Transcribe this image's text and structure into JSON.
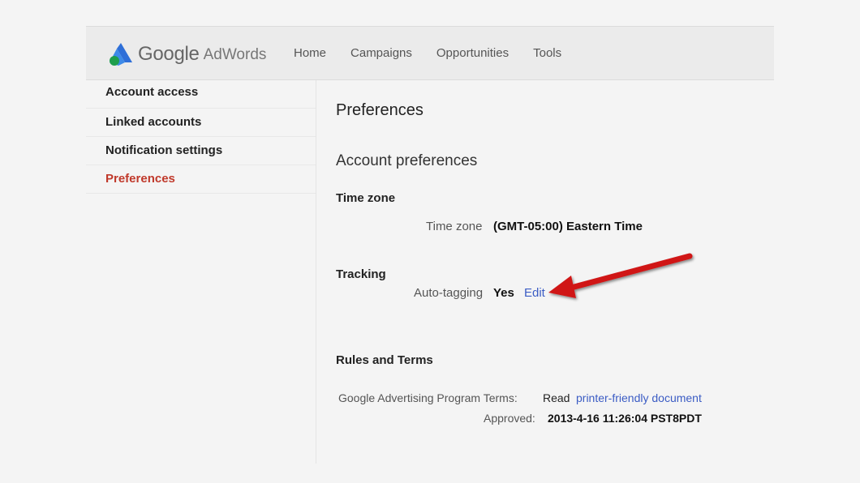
{
  "brand": {
    "google": "Google",
    "product": "AdWords"
  },
  "nav": {
    "items": [
      "Home",
      "Campaigns",
      "Opportunities",
      "Tools"
    ]
  },
  "sidebar": {
    "items": [
      {
        "label": "Account access"
      },
      {
        "label": "Linked accounts"
      },
      {
        "label": "Notification settings"
      },
      {
        "label": "Preferences",
        "active": true
      }
    ]
  },
  "main": {
    "title": "Preferences",
    "section_title": "Account preferences",
    "timezone": {
      "heading": "Time zone",
      "label": "Time zone",
      "value": "(GMT-05:00) Eastern Time"
    },
    "tracking": {
      "heading": "Tracking",
      "label": "Auto-tagging",
      "value": "Yes",
      "edit_label": "Edit"
    },
    "rules": {
      "heading": "Rules and Terms",
      "terms_label": "Google Advertising Program Terms:",
      "read_text": "Read",
      "doc_link": "printer-friendly document",
      "approved_label": "Approved:",
      "approved_value": "2013-4-16 11:26:04 PST8PDT"
    }
  },
  "colors": {
    "active_sidebar": "#c0392b",
    "link": "#3b5cc4",
    "arrow": "#d01818"
  }
}
